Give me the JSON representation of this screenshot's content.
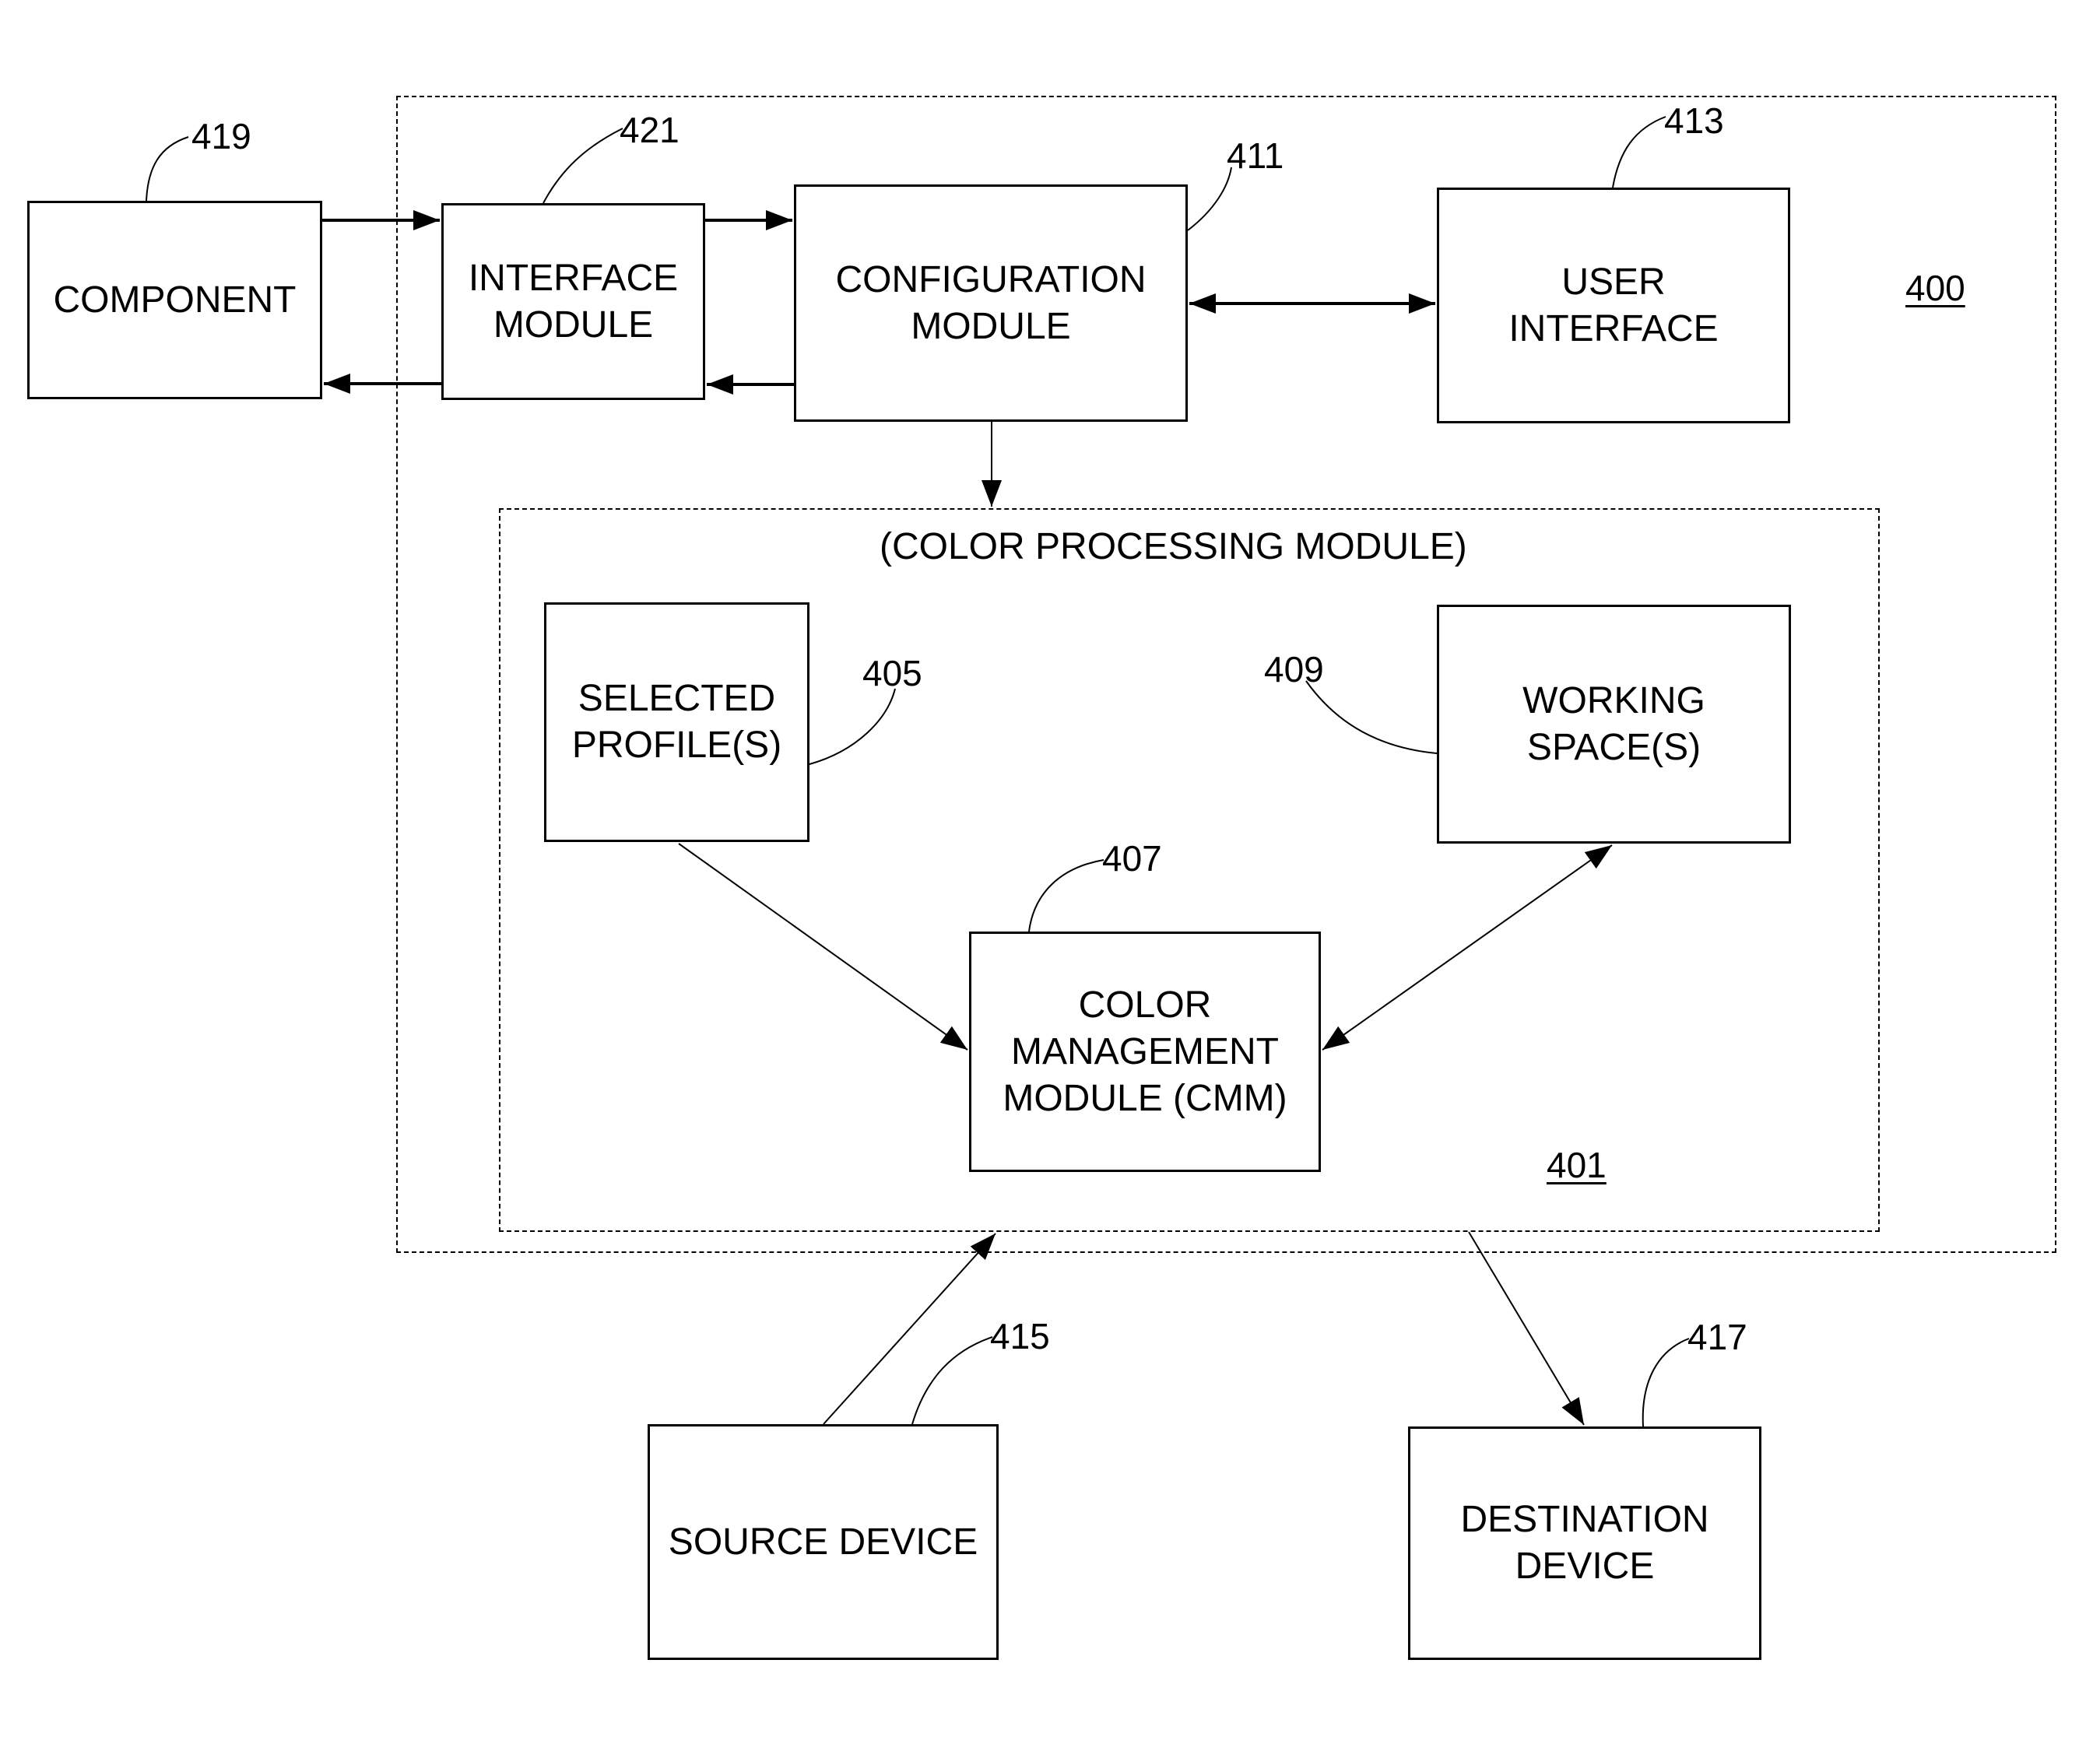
{
  "diagram": {
    "containers": {
      "system": {
        "ref": "400"
      },
      "color_processing": {
        "title": "(COLOR PROCESSING MODULE)",
        "ref": "401"
      }
    },
    "blocks": {
      "component": {
        "label": "COMPONENT",
        "ref": "419"
      },
      "interface_module": {
        "label": "INTERFACE\nMODULE",
        "ref": "421"
      },
      "configuration_module": {
        "label": "CONFIGURATION\nMODULE",
        "ref": "411"
      },
      "user_interface": {
        "label": "USER\nINTERFACE",
        "ref": "413"
      },
      "selected_profiles": {
        "label": "SELECTED\nPROFILE(S)",
        "ref": "405"
      },
      "working_spaces": {
        "label": "WORKING\nSPACE(S)",
        "ref": "409"
      },
      "cmm": {
        "label": "COLOR\nMANAGEMENT\nMODULE (CMM)",
        "ref": "407"
      },
      "source_device": {
        "label": "SOURCE DEVICE",
        "ref": "415"
      },
      "destination_device": {
        "label": "DESTINATION\nDEVICE",
        "ref": "417"
      }
    },
    "connections": [
      {
        "from": "component",
        "to": "interface_module",
        "direction": "forward"
      },
      {
        "from": "interface_module",
        "to": "component",
        "direction": "forward"
      },
      {
        "from": "interface_module",
        "to": "configuration_module",
        "direction": "forward"
      },
      {
        "from": "configuration_module",
        "to": "interface_module",
        "direction": "forward"
      },
      {
        "from": "configuration_module",
        "to": "user_interface",
        "direction": "bidirectional"
      },
      {
        "from": "configuration_module",
        "to": "color_processing",
        "direction": "forward"
      },
      {
        "from": "selected_profiles",
        "to": "cmm",
        "direction": "forward"
      },
      {
        "from": "cmm",
        "to": "working_spaces",
        "direction": "bidirectional"
      },
      {
        "from": "source_device",
        "to": "color_processing",
        "direction": "forward"
      },
      {
        "from": "color_processing",
        "to": "destination_device",
        "direction": "forward"
      }
    ]
  }
}
